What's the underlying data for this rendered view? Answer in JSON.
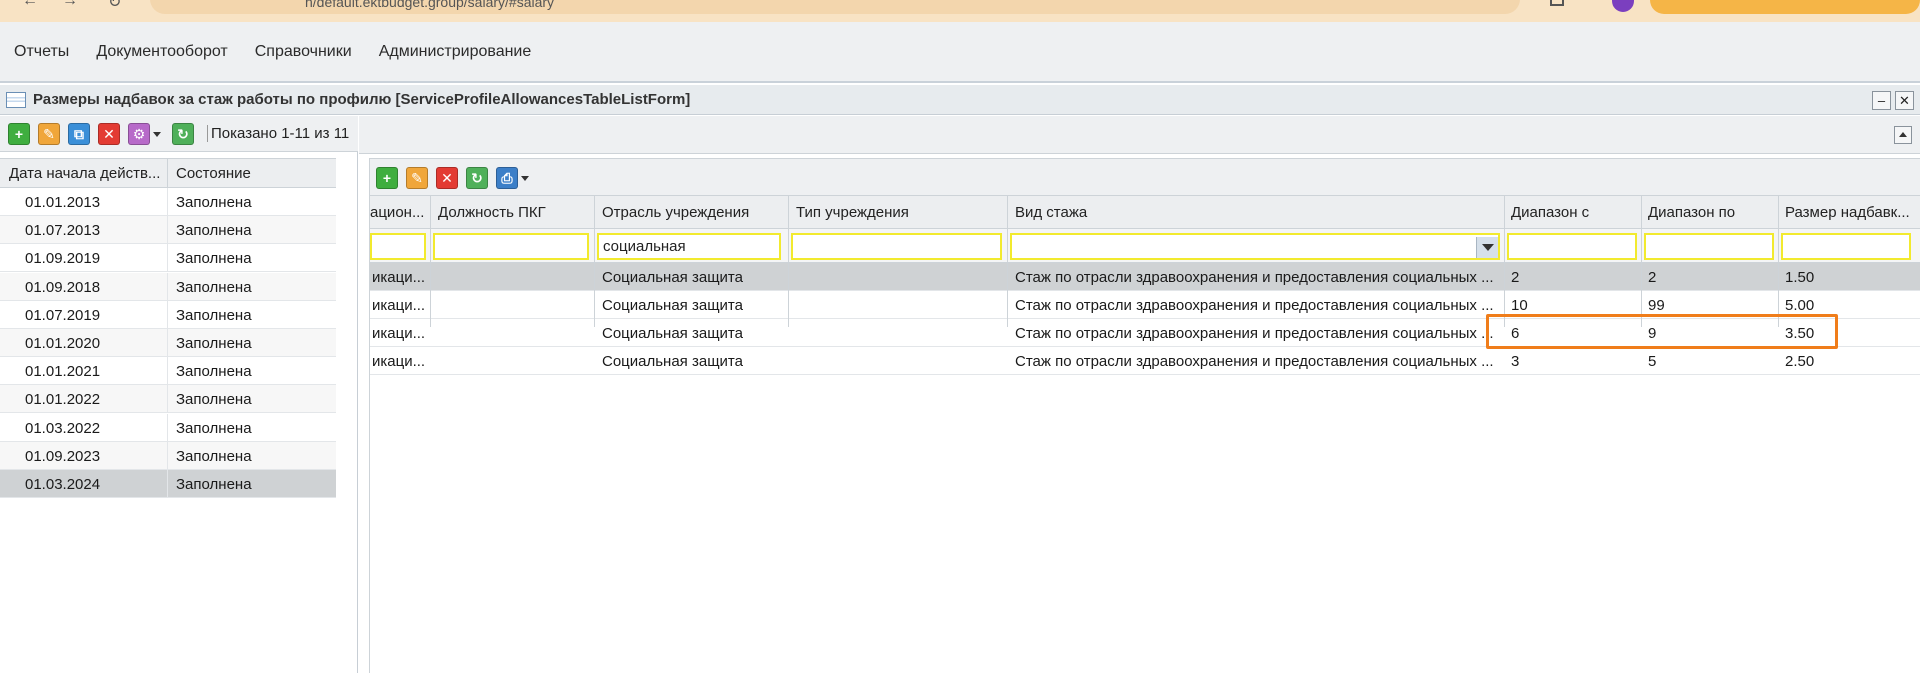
{
  "browser": {
    "url_visible": "h/default.ektbudget.group/salary/#salary"
  },
  "app_menu": {
    "items": [
      "Отчеты",
      "Документооборот",
      "Справочники",
      "Администрирование"
    ]
  },
  "window": {
    "title": "Размеры надбавок за стаж работы по профилю [ServiceProfileAllowancesTableListForm]"
  },
  "left_panel": {
    "toolbar": {
      "shown_label": "Показано 1-11 из 11"
    },
    "columns": [
      "Дата начала действ...",
      "Состояние"
    ],
    "rows": [
      {
        "date": "01.01.2013",
        "state": "Заполнена"
      },
      {
        "date": "01.07.2013",
        "state": "Заполнена"
      },
      {
        "date": "01.09.2019",
        "state": "Заполнена"
      },
      {
        "date": "01.09.2018",
        "state": "Заполнена"
      },
      {
        "date": "01.07.2019",
        "state": "Заполнена"
      },
      {
        "date": "01.01.2020",
        "state": "Заполнена"
      },
      {
        "date": "01.01.2021",
        "state": "Заполнена"
      },
      {
        "date": "01.01.2022",
        "state": "Заполнена"
      },
      {
        "date": "01.03.2022",
        "state": "Заполнена"
      },
      {
        "date": "01.09.2023",
        "state": "Заполнена"
      },
      {
        "date": "01.03.2024",
        "state": "Заполнена"
      }
    ],
    "selected_row": 10
  },
  "right_panel": {
    "columns": [
      "ацион...",
      "Должность ПКГ",
      "Отрасль учреждения",
      "Тип учреждения",
      "Вид стажа",
      "Диапазон с",
      "Диапазон по",
      "Размер надбавк..."
    ],
    "filters": {
      "col0": "",
      "position_pkg": "",
      "industry": "социальная",
      "type": "",
      "experience": "",
      "range_from": "",
      "range_to": "",
      "allowance": ""
    },
    "rows": [
      {
        "col0": "икаци...",
        "pkg": "",
        "industry": "Социальная защита",
        "type": "",
        "experience": "Стаж по отрасли здравоохранения и предоставления социальных ...",
        "from": "2",
        "to": "2",
        "size": "1.50"
      },
      {
        "col0": "икаци...",
        "pkg": "",
        "industry": "Социальная защита",
        "type": "",
        "experience": "Стаж по отрасли здравоохранения и предоставления социальных ...",
        "from": "10",
        "to": "99",
        "size": "5.00"
      },
      {
        "col0": "икаци...",
        "pkg": "",
        "industry": "Социальная защита",
        "type": "",
        "experience": "Стаж по отрасли здравоохранения и предоставления социальных ...",
        "from": "6",
        "to": "9",
        "size": "3.50"
      },
      {
        "col0": "икаци...",
        "pkg": "",
        "industry": "Социальная защита",
        "type": "",
        "experience": "Стаж по отрасли здравоохранения и предоставления социальных ...",
        "from": "3",
        "to": "5",
        "size": "2.50"
      }
    ],
    "selected_row": 0,
    "highlight_color": "#f07d1a"
  },
  "icons": {
    "add": "plus-icon",
    "edit": "pencil-icon",
    "copy": "copy-icon",
    "delete": "delete-icon",
    "settings": "gear-icon",
    "refresh": "refresh-icon",
    "print": "print-icon"
  }
}
